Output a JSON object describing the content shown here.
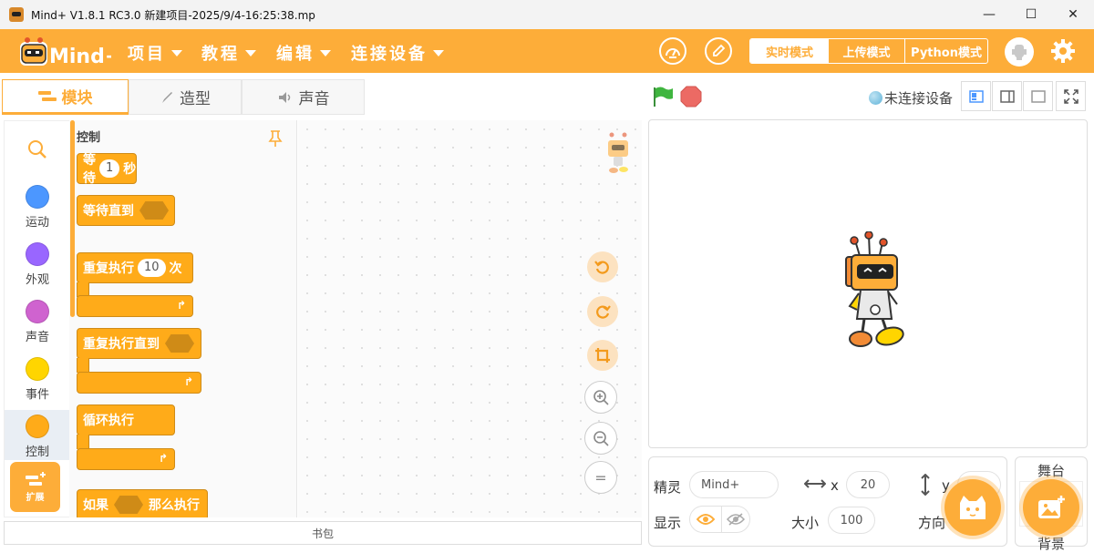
{
  "window": {
    "title": "Mind+ V1.8.1 RC3.0   新建项目-2025/9/4-16:25:38.mp",
    "minimize_glyph": "—",
    "maximize_glyph": "☐",
    "close_glyph": "✕"
  },
  "menubar": {
    "logo_text": "Mind+",
    "items": [
      {
        "label": "项目"
      },
      {
        "label": "教程"
      },
      {
        "label": "编辑"
      },
      {
        "label": "连接设备"
      }
    ],
    "modes": [
      "实时模式",
      "上传模式",
      "Python模式"
    ],
    "active_mode": "实时模式"
  },
  "tabs": [
    {
      "label": "模块",
      "icon": "blocks-icon"
    },
    {
      "label": "造型",
      "icon": "brush-icon"
    },
    {
      "label": "声音",
      "icon": "speaker-icon"
    }
  ],
  "categories": [
    {
      "label": "运动",
      "color": "#4c97ff"
    },
    {
      "label": "外观",
      "color": "#9966ff"
    },
    {
      "label": "声音",
      "color": "#cf63cf"
    },
    {
      "label": "事件",
      "color": "#ffd500"
    },
    {
      "label": "控制",
      "color": "#ffab19"
    }
  ],
  "extension": {
    "label": "扩展"
  },
  "palette": {
    "heading": "控制",
    "blocks": {
      "wait": {
        "text": "等待",
        "value": "1",
        "unit": "秒"
      },
      "wait_until": {
        "text": "等待直到"
      },
      "repeat": {
        "text": "重复执行",
        "value": "10",
        "unit": "次"
      },
      "repeat_until": {
        "text": "重复执行直到"
      },
      "forever": {
        "text": "循环执行"
      },
      "if_then": {
        "text_a": "如果",
        "text_b": "那么执行"
      }
    }
  },
  "workspace": {
    "zoom_reset_label": "="
  },
  "backpack": {
    "label": "书包"
  },
  "stage_header": {
    "connection_status": "未连接设备"
  },
  "sprite_info": {
    "sprite_label": "精灵",
    "sprite_name": "Mind+",
    "x_label": "x",
    "x_value": "20",
    "y_label": "y",
    "show_label": "显示",
    "size_label": "大小",
    "size_value": "100",
    "direction_label": "方向"
  },
  "stage_panel": {
    "title": "舞台",
    "backdrop_label": "背景"
  },
  "colors": {
    "brand": "#fdad39",
    "control_block": "#ffab19",
    "green_flag": "#3fb53f",
    "stop": "#ec6a64"
  }
}
